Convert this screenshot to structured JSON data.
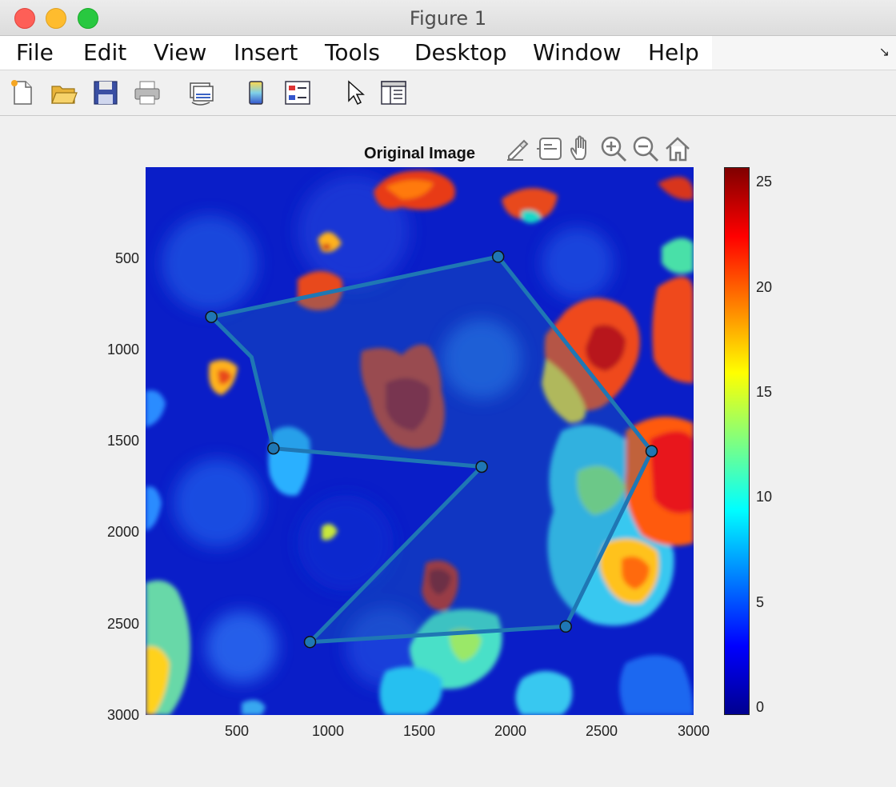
{
  "window": {
    "title": "Figure 1"
  },
  "menu": {
    "items": [
      "File",
      "Edit",
      "View",
      "Insert",
      "Tools",
      "Desktop",
      "Window",
      "Help"
    ]
  },
  "toolbar": {
    "icons": [
      "new-figure-icon",
      "open-file-icon",
      "save-icon",
      "print-icon",
      "link-plot-icon",
      "colorbar-icon",
      "legend-icon",
      "pointer-icon",
      "property-inspector-icon"
    ]
  },
  "axes": {
    "title": "Original Image",
    "toolbar_icons": [
      "brush-icon",
      "data-tips-icon",
      "pan-icon",
      "zoom-in-icon",
      "zoom-out-icon",
      "home-icon"
    ]
  },
  "chart_data": {
    "type": "heatmap",
    "title": "Original Image",
    "xlabel": "",
    "ylabel": "",
    "xlim": [
      0,
      3000
    ],
    "ylim": [
      3000,
      0
    ],
    "x_ticks": [
      "500",
      "1000",
      "1500",
      "2000",
      "2500",
      "3000"
    ],
    "y_ticks": [
      "500",
      "1000",
      "1500",
      "2000",
      "2500",
      "3000"
    ],
    "colormap": "jet",
    "colorbar": {
      "range": [
        -0.5,
        25.7
      ],
      "ticks": [
        "0",
        "5",
        "10",
        "15",
        "20",
        "25"
      ]
    },
    "polygon": {
      "color": "#1f77b4",
      "vertices": [
        {
          "x": 1930,
          "y": 490
        },
        {
          "x": 2770,
          "y": 1555
        },
        {
          "x": 2300,
          "y": 2515
        },
        {
          "x": 900,
          "y": 2600
        },
        {
          "x": 1840,
          "y": 1640
        },
        {
          "x": 700,
          "y": 1540
        },
        {
          "x": 580,
          "y": 1040
        },
        {
          "x": 360,
          "y": 820
        }
      ],
      "markers": [
        {
          "x": 1930,
          "y": 490
        },
        {
          "x": 2770,
          "y": 1555
        },
        {
          "x": 2300,
          "y": 2515
        },
        {
          "x": 900,
          "y": 2600
        },
        {
          "x": 1840,
          "y": 1640
        },
        {
          "x": 700,
          "y": 1540
        },
        {
          "x": 360,
          "y": 820
        }
      ]
    }
  }
}
